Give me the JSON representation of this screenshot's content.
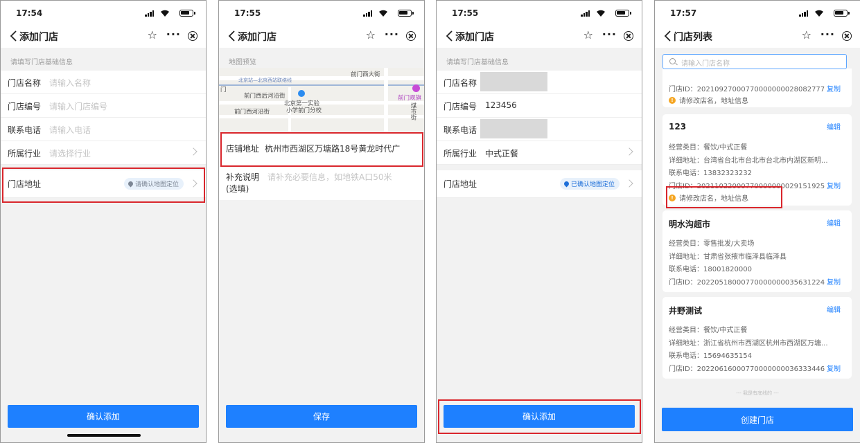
{
  "screens": [
    {
      "time": "17:54",
      "title": "添加门店",
      "section_label": "请填写门店基础信息",
      "fields": [
        {
          "label": "门店名称",
          "placeholder": "请输入名称"
        },
        {
          "label": "门店编号",
          "placeholder": "请输入门店编号"
        },
        {
          "label": "联系电话",
          "placeholder": "请输入电话"
        },
        {
          "label": "所属行业",
          "placeholder": "请选择行业"
        }
      ],
      "address_label": "门店地址",
      "address_badge": "请确认地图定位",
      "button": "确认添加"
    },
    {
      "time": "17:55",
      "title": "添加门店",
      "section_label": "地图预览",
      "map_labels": [
        "前门西大街",
        "北京站—北京西站联络线",
        "前门西后河沿街",
        "北京第一实验",
        "小学前门分校",
        "前门西河沿街",
        "前门观旗",
        "煤市街"
      ],
      "shop_address_label": "店铺地址",
      "shop_address_value": "杭州市西湖区万塘路18号黄龙时代广",
      "note_label_1": "补充说明",
      "note_label_2": "(选填)",
      "note_placeholder": "请补充必要信息，如地铁A口50米",
      "button": "保存"
    },
    {
      "time": "17:55",
      "title": "添加门店",
      "section_label": "请填写门店基础信息",
      "fields": [
        {
          "label": "门店名称",
          "value": ""
        },
        {
          "label": "门店编号",
          "value": "123456"
        },
        {
          "label": "联系电话",
          "value": ""
        },
        {
          "label": "所属行业",
          "value": "中式正餐"
        }
      ],
      "address_label": "门店地址",
      "address_badge": "已确认地图定位",
      "button": "确认添加"
    },
    {
      "time": "17:57",
      "title": "门店列表",
      "search_placeholder": "请输入门店名称",
      "partial_card": {
        "store_id": "门店ID：20210927000770000000028082777",
        "copy": "复制",
        "warning": "请修改店名，地址信息"
      },
      "cards": [
        {
          "name": "123",
          "edit": "编辑",
          "category": "经营类目：餐饮/中式正餐",
          "address": "详细地址：台湾省台北市台北市台北市内湖区新明...",
          "phone": "联系电话：13832323232",
          "store_id": "门店ID：20211022000770000000029151925",
          "copy": "复制",
          "warning": "请修改店名，地址信息"
        },
        {
          "name": "明水沟超市",
          "edit": "编辑",
          "category": "经营类目：零售批发/大卖场",
          "address": "详细地址：甘肃省张掖市临泽县临泽县",
          "phone": "联系电话：18001820000",
          "store_id": "门店ID：20220518000770000000035631224",
          "copy": "复制"
        },
        {
          "name": "井野测试",
          "edit": "编辑",
          "category": "经营类目：餐饮/中式正餐",
          "address": "详细地址：浙江省杭州市西湖区杭州市西湖区万塘...",
          "phone": "联系电话：15694635154",
          "store_id": "门店ID：20220616000770000000036333446",
          "copy": "复制"
        }
      ],
      "footer_note": "--- 我是有底线的 ---",
      "button": "创建门店"
    }
  ],
  "colors": {
    "accent": "#1e80ff",
    "highlight": "#d9262c",
    "warning": "#f5a623"
  }
}
